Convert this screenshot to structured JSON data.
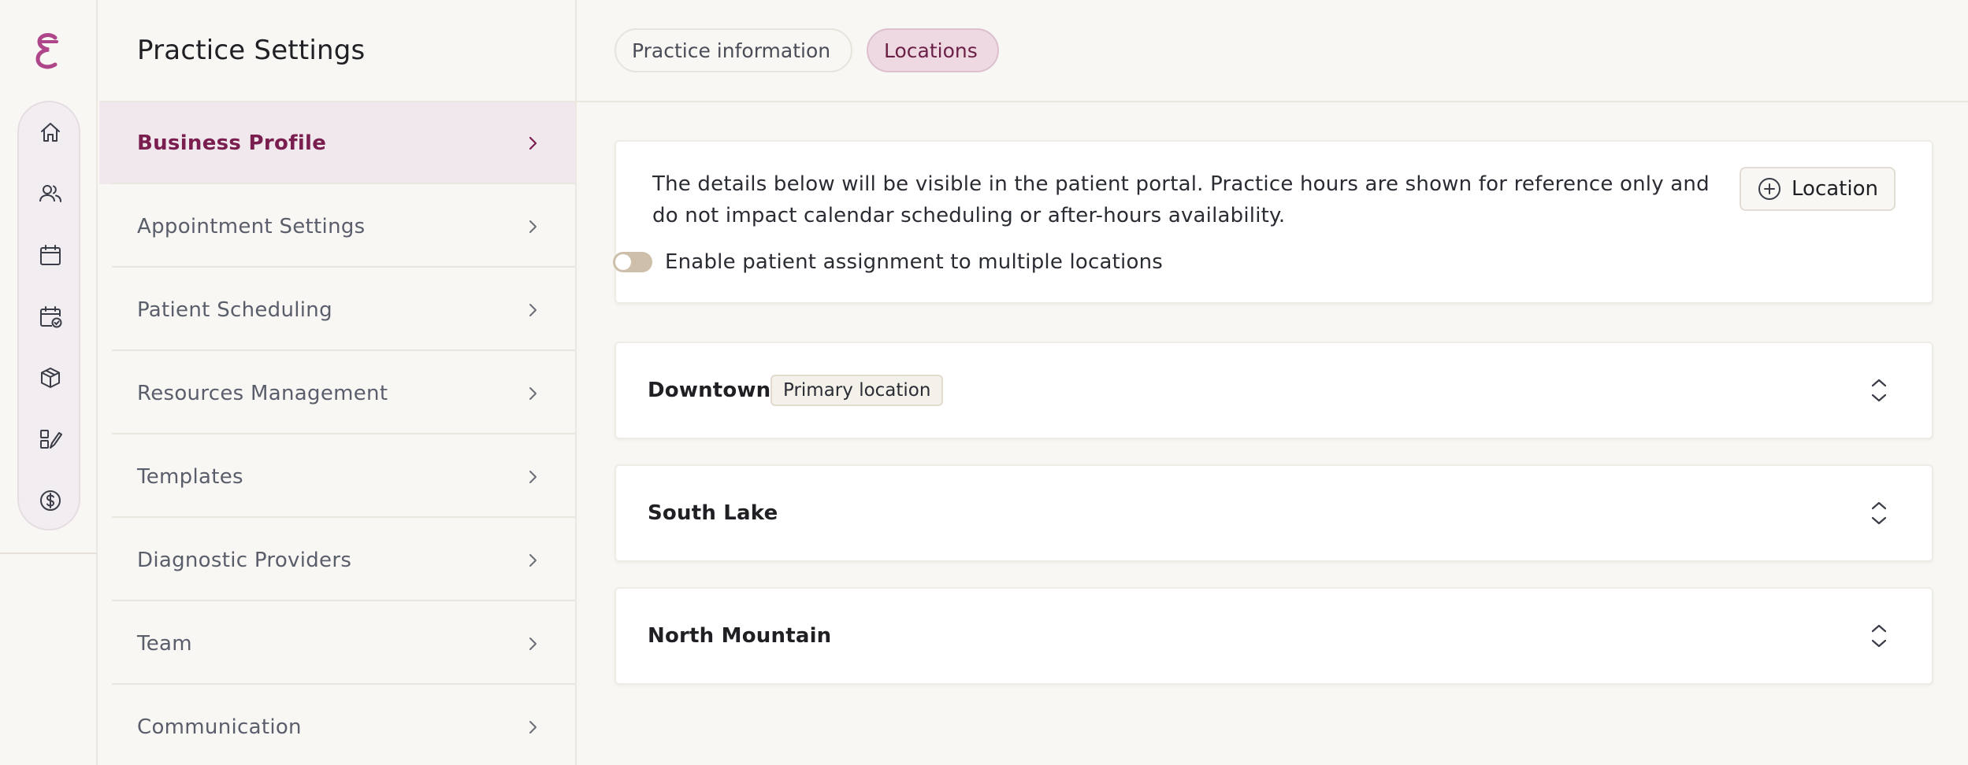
{
  "settings": {
    "title": "Practice Settings",
    "items": [
      {
        "label": "Business Profile",
        "active": true
      },
      {
        "label": "Appointment Settings"
      },
      {
        "label": "Patient Scheduling"
      },
      {
        "label": "Resources Management"
      },
      {
        "label": "Templates"
      },
      {
        "label": "Diagnostic Providers"
      },
      {
        "label": "Team"
      },
      {
        "label": "Communication"
      }
    ]
  },
  "tabs": [
    {
      "label": "Practice information"
    },
    {
      "label": "Locations",
      "active": true
    }
  ],
  "info": {
    "description": "The details below will be visible in the patient portal. Practice hours are shown for reference only and do not impact calendar scheduling or after-hours availability.",
    "add_button": "Location",
    "toggle_label": "Enable patient assignment to multiple locations",
    "toggle_on": false
  },
  "locations": [
    {
      "name": "Downtown",
      "badge": "Primary location"
    },
    {
      "name": "South Lake"
    },
    {
      "name": "North Mountain"
    }
  ],
  "rail_icons": [
    "home-icon",
    "users-icon",
    "calendar-icon",
    "calendar-check-icon",
    "box-icon",
    "checklist-edit-icon",
    "dollar-icon"
  ],
  "colors": {
    "brand": "#b0468a",
    "active_text": "#7a1d4f",
    "active_bg": "#f0e8ec",
    "tab_active_bg": "#eed9e2"
  }
}
